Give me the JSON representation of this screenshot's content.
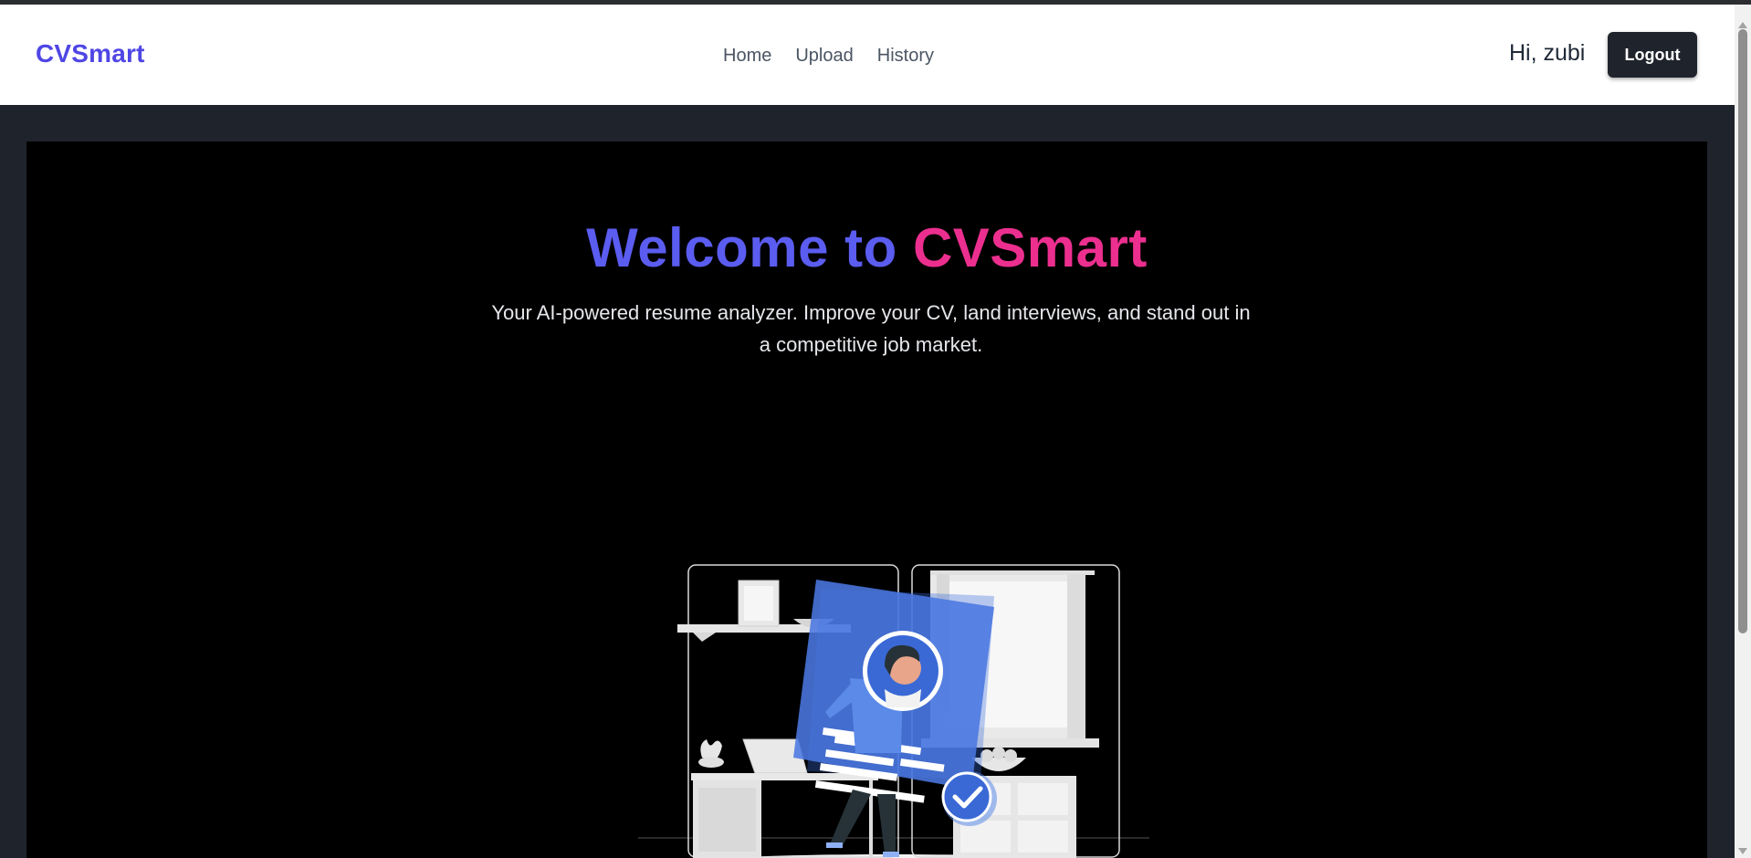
{
  "navbar": {
    "brand": "CVSmart",
    "links": [
      {
        "label": "Home"
      },
      {
        "label": "Upload"
      },
      {
        "label": "History"
      }
    ],
    "greeting": "Hi, zubi",
    "logout_label": "Logout"
  },
  "hero": {
    "title_part1": "Welcome to",
    "title_part2": "CVSmart",
    "subtitle": "Your AI-powered resume analyzer. Improve your CV, land interviews, and stand out in a competitive job market."
  },
  "colors": {
    "brand": "#4f46e5",
    "title_primary": "#5b5cf0",
    "title_accent": "#ec2f8f",
    "illustration_accent": "#4a78e0"
  },
  "illustration": {
    "icons": [
      "resume-card-icon",
      "checkmark-badge-icon",
      "person-icon"
    ]
  }
}
